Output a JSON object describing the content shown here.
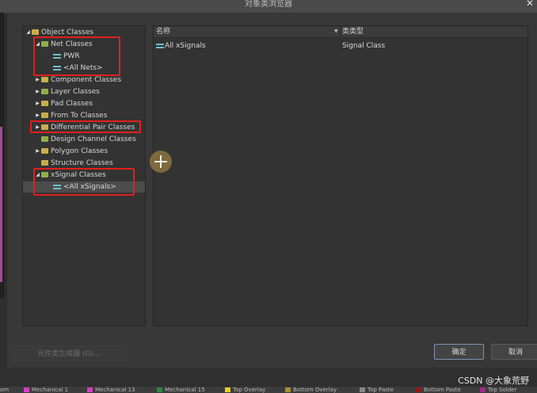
{
  "window": {
    "title": "对象类浏览器"
  },
  "tree": [
    {
      "label": "Object Classes",
      "arrow": "◢",
      "icon": "folder-icon"
    },
    {
      "label": "Net Classes",
      "arrow": "◢",
      "icon": "folder-icon"
    },
    {
      "label": "PWR",
      "arrow": "",
      "icon": "net-icon"
    },
    {
      "label": "<All Nets>",
      "arrow": "",
      "icon": "net-icon"
    },
    {
      "label": "Component Classes",
      "arrow": "▶",
      "icon": "folder-icon"
    },
    {
      "label": "Layer Classes",
      "arrow": "▶",
      "icon": "folder-icon"
    },
    {
      "label": "Pad Classes",
      "arrow": "▶",
      "icon": "folder-icon"
    },
    {
      "label": "From To Classes",
      "arrow": "▶",
      "icon": "folder-icon"
    },
    {
      "label": "Differential Pair Classes",
      "arrow": "▶",
      "icon": "folder-icon"
    },
    {
      "label": "Design Channel Classes",
      "arrow": "",
      "icon": "folder-icon"
    },
    {
      "label": "Polygon Classes",
      "arrow": "▶",
      "icon": "folder-icon"
    },
    {
      "label": "Structure Classes",
      "arrow": "",
      "icon": "folder-icon"
    },
    {
      "label": "xSignal Classes",
      "arrow": "◢",
      "icon": "folder-icon"
    },
    {
      "label": "<All xSignals>",
      "arrow": "",
      "icon": "net-icon"
    }
  ],
  "list": {
    "columns": {
      "name": "名称",
      "type": "类类型"
    },
    "rows": [
      {
        "name": "All xSignals",
        "type": "Signal Class"
      }
    ]
  },
  "buttons": {
    "generator": "元件类生成器 (G)...",
    "ok": "确定",
    "cancel": "取消"
  },
  "watermark": "CSDN @大象荒野",
  "layers": [
    {
      "label": "om",
      "color": ""
    },
    {
      "label": "Mechanical 1",
      "color": "#d040c0"
    },
    {
      "label": "Mechanical 13",
      "color": "#d040c0"
    },
    {
      "label": "Mechanical 15",
      "color": "#2a8a3a"
    },
    {
      "label": "Top Overlay",
      "color": "#e8d020"
    },
    {
      "label": "Bottom Overlay",
      "color": "#a89030"
    },
    {
      "label": "Top Paste",
      "color": "#888888"
    },
    {
      "label": "Bottom Paste",
      "color": "#8a1a1a"
    },
    {
      "label": "Top Solder",
      "color": "#a02a8a"
    }
  ]
}
